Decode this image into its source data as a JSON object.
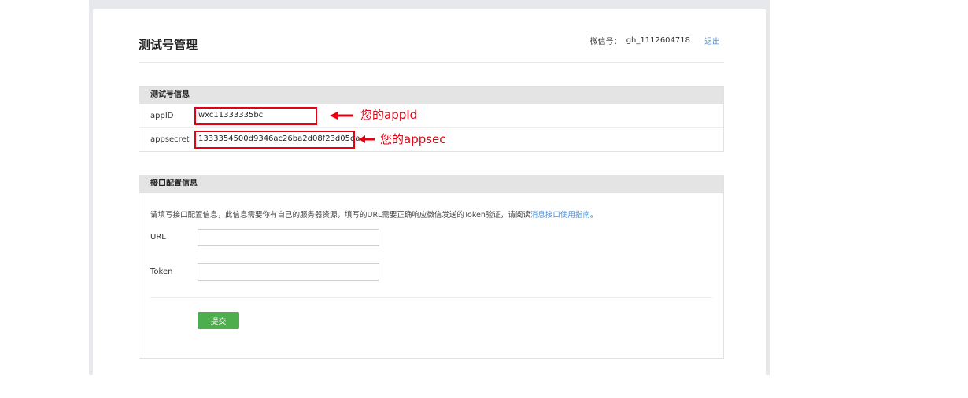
{
  "header": {
    "title": "测试号管理",
    "account_label": "微信号：",
    "account_id": "gh_1112604718",
    "logout": "退出"
  },
  "test_account": {
    "section_title": "测试号信息",
    "appid_label": "appID",
    "appid_value": "wxc11333335bc",
    "appsecret_label": "appsecret",
    "appsecret_value": "1333354500d9346ac26ba2d08f23d05da"
  },
  "annotations": {
    "appid_note": "您的appId",
    "appsecret_note": "您的appsec",
    "highlight_color": "#e60012"
  },
  "interface_config": {
    "section_title": "接口配置信息",
    "description_prefix": "请填写接口配置信息，此信息需要你有自己的服务器资源，填写的URL需要正确响应微信发送的Token验证，请阅读",
    "description_link": "消息接口使用指南",
    "description_suffix": "。",
    "url_label": "URL",
    "url_value": "",
    "token_label": "Token",
    "token_value": "",
    "submit_label": "提交"
  },
  "colors": {
    "accent_link": "#4a90d9",
    "submit_green": "#4cae4c",
    "section_header_bg": "#e4e4e4"
  }
}
